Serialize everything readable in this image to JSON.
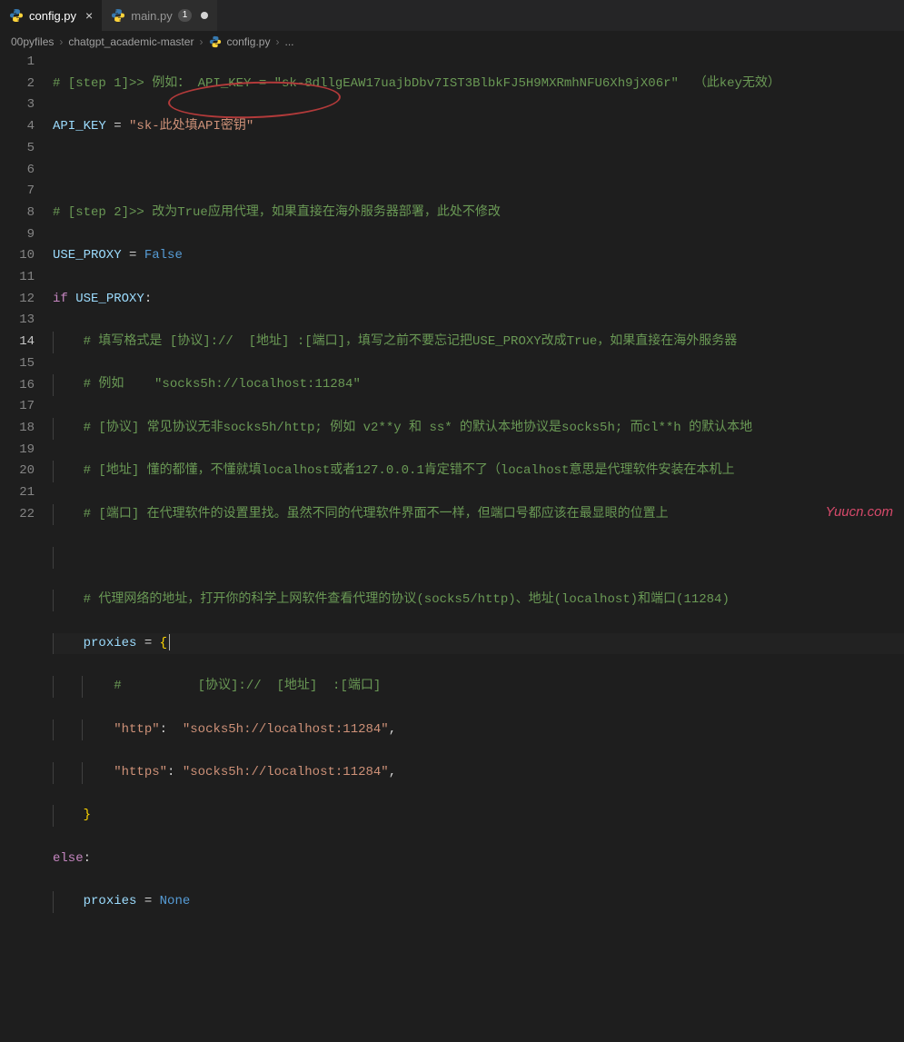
{
  "tabs": [
    {
      "label": "config.py",
      "active": true,
      "close": "×"
    },
    {
      "label": "main.py",
      "badge": "1",
      "active": false
    }
  ],
  "breadcrumb": {
    "parts": [
      "00pyfiles",
      "chatgpt_academic-master",
      "config.py",
      "..."
    ],
    "sep": "›"
  },
  "gutter": [
    "1",
    "2",
    "3",
    "4",
    "5",
    "6",
    "7",
    "8",
    "9",
    "10",
    "11",
    "12",
    "13",
    "14",
    "15",
    "16",
    "17",
    "18",
    "19",
    "20",
    "21",
    "22"
  ],
  "active_line": 14,
  "code": {
    "l1": "# [step 1]>> 例如： API_KEY = \"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\"  （此key无效）",
    "l2_var": "API_KEY",
    "l2_eq": " = ",
    "l2_str": "\"sk-此处填API密钥\"",
    "l4": "# [step 2]>> 改为True应用代理，如果直接在海外服务器部署，此处不修改",
    "l5_var": "USE_PROXY",
    "l5_eq": " = ",
    "l5_val": "False",
    "l6_if": "if",
    "l6_cond": " USE_PROXY",
    "l6_colon": ":",
    "l7": "# 填写格式是 [协议]://  [地址] :[端口]，填写之前不要忘记把USE_PROXY改成True，如果直接在海外服务器",
    "l8": "# 例如    \"socks5h://localhost:11284\"",
    "l9": "# [协议] 常见协议无非socks5h/http; 例如 v2**y 和 ss* 的默认本地协议是socks5h; 而cl**h 的默认本地",
    "l10": "# [地址] 懂的都懂，不懂就填localhost或者127.0.0.1肯定错不了（localhost意思是代理软件安装在本机上",
    "l11": "# [端口] 在代理软件的设置里找。虽然不同的代理软件界面不一样，但端口号都应该在最显眼的位置上",
    "l13": "# 代理网络的地址，打开你的科学上网软件查看代理的协议(socks5/http)、地址(localhost)和端口(11284)",
    "l14_var": "proxies",
    "l14_eq": " = ",
    "l14_brace": "{",
    "l15": "#          [协议]://  [地址]  :[端口]",
    "l16_k": "\"http\"",
    "l16_c": ":  ",
    "l16_v": "\"socks5h://localhost:11284\"",
    "l16_comma": ",",
    "l17_k": "\"https\"",
    "l17_c": ": ",
    "l17_v": "\"socks5h://localhost:11284\"",
    "l17_comma": ",",
    "l18_brace": "}",
    "l19_else": "else",
    "l19_colon": ":",
    "l20_var": "proxies",
    "l20_eq": " = ",
    "l20_val": "None"
  },
  "watermark": "Yuucn.com"
}
